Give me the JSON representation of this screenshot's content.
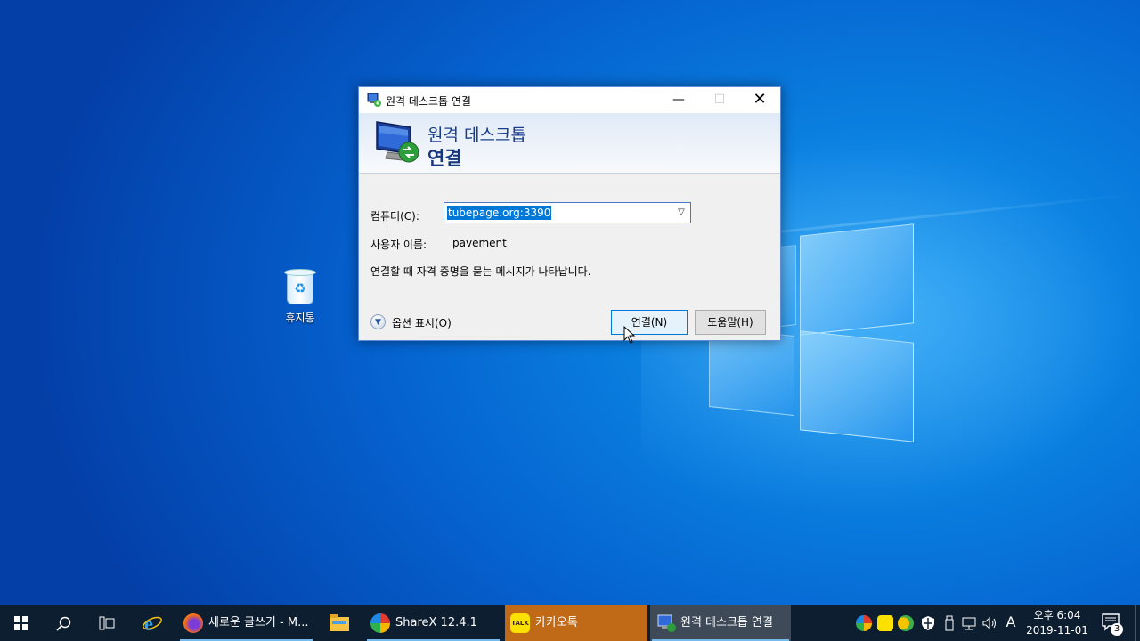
{
  "desktop": {
    "recycle_bin_label": "휴지통"
  },
  "dialog": {
    "title": "원격 데스크톱 연결",
    "banner_line1": "원격 데스크톱",
    "banner_line2": "연결",
    "computer_label": "컴퓨터(C):",
    "computer_value": "tubepage.org:3390",
    "username_label": "사용자 이름:",
    "username_value": "pavement",
    "info_text": "연결할 때 자격 증명을 묻는 메시지가 나타납니다.",
    "options_label": "옵션 표시(O)",
    "connect_button": "연결(N)",
    "help_button": "도움말(H)",
    "minimize_glyph": "—",
    "maximize_glyph": "☐",
    "close_glyph": "✕"
  },
  "taskbar": {
    "apps": [
      {
        "label": "새로운 글쓰기 - M...",
        "icon": "firefox-icon"
      },
      {
        "label": "",
        "icon": "file-explorer-icon"
      },
      {
        "label": "ShareX 12.4.1",
        "icon": "sharex-icon"
      },
      {
        "label": "카카오톡",
        "icon": "kakaotalk-icon"
      },
      {
        "label": "원격 데스크톱 연결",
        "icon": "remote-desktop-icon"
      }
    ],
    "ime": "A",
    "time": "오후 6:04",
    "date": "2019-11-01",
    "notification_count": "3"
  },
  "colors": {
    "desktop_blue": "#0a7fe0",
    "taskbar": "#0e1e31",
    "kakaotalk_highlight": "#c06a18",
    "active_app": "#3e4a58",
    "selection": "#0078d7"
  }
}
